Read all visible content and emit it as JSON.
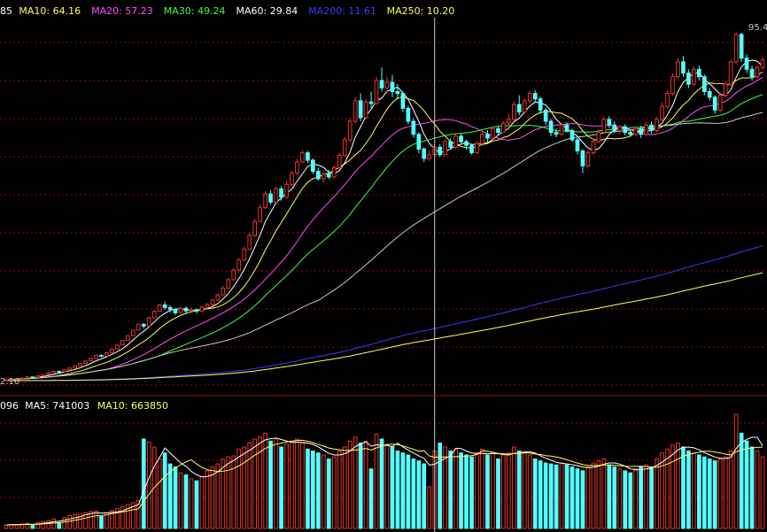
{
  "colors": {
    "background": "#000000",
    "up": "#e8352a",
    "down": "#54ffff",
    "grid": "#8a1010",
    "crosshair": "#c8c8c8",
    "ma5": "#ffffff",
    "ma10": "#ffff5a",
    "ma20": "#ff4cff",
    "ma30": "#3cff3c",
    "ma60": "#c8c8c8",
    "ma200": "#3a3aff",
    "ma250": "#ffff5a",
    "vma5": "#ffffff",
    "vma10": "#ffff5a"
  },
  "price_panel": {
    "legend": [
      {
        "label": "85",
        "color": "#ffffff"
      },
      {
        "label": "MA10: 64.16",
        "color": "#ffff5a"
      },
      {
        "label": "MA20: 57.23",
        "color": "#ff4cff"
      },
      {
        "label": "MA30: 49.24",
        "color": "#3cff3c"
      },
      {
        "label": "MA60: 29.84",
        "color": "#ffffff"
      },
      {
        "label": "MA200: 11.61",
        "color": "#3a3aff"
      },
      {
        "label": "MA250: 10.20",
        "color": "#ffff5a"
      }
    ],
    "max_label": "95.4",
    "min_label": "2.10"
  },
  "volume_panel": {
    "legend": [
      {
        "label": "096",
        "color": "#ffffff"
      },
      {
        "label": "MA5: 741003",
        "color": "#ffffff"
      },
      {
        "label": "MA10: 663850",
        "color": "#ffff5a"
      }
    ]
  },
  "chart_data": {
    "type": "candlestick",
    "price_range": [
      2.1,
      98
    ],
    "volume_range": [
      0,
      1150000
    ],
    "crosshair_index": 81,
    "candles": [
      [
        2.1,
        2.3,
        2.0,
        2.4,
        35000
      ],
      [
        2.3,
        2.5,
        2.2,
        2.6,
        40000
      ],
      [
        2.5,
        2.6,
        2.4,
        2.7,
        38000
      ],
      [
        2.6,
        2.8,
        2.5,
        2.9,
        45000
      ],
      [
        2.8,
        3.1,
        2.7,
        3.2,
        52000
      ],
      [
        3.1,
        3.0,
        2.9,
        3.2,
        30000
      ],
      [
        3.0,
        3.4,
        2.9,
        3.5,
        60000
      ],
      [
        3.4,
        3.8,
        3.3,
        3.9,
        70000
      ],
      [
        3.8,
        4.2,
        3.7,
        4.3,
        80000
      ],
      [
        4.2,
        4.6,
        4.1,
        4.7,
        95000
      ],
      [
        4.6,
        4.5,
        4.3,
        4.8,
        60000
      ],
      [
        4.5,
        5.0,
        4.4,
        5.1,
        110000
      ],
      [
        5.0,
        5.5,
        4.9,
        5.6,
        130000
      ],
      [
        5.5,
        6.1,
        5.4,
        6.2,
        140000
      ],
      [
        6.1,
        6.7,
        6.0,
        6.8,
        150000
      ],
      [
        6.7,
        7.4,
        6.6,
        7.5,
        160000
      ],
      [
        7.4,
        8.1,
        7.3,
        8.2,
        170000
      ],
      [
        8.1,
        8.9,
        8.0,
        9.0,
        175000
      ],
      [
        8.9,
        8.7,
        8.4,
        9.2,
        120000
      ],
      [
        8.7,
        9.6,
        8.6,
        9.7,
        160000
      ],
      [
        9.6,
        10.6,
        9.5,
        10.7,
        180000
      ],
      [
        10.6,
        11.7,
        10.5,
        11.8,
        200000
      ],
      [
        11.7,
        12.9,
        11.6,
        13.0,
        220000
      ],
      [
        12.9,
        14.2,
        12.8,
        14.3,
        240000
      ],
      [
        14.2,
        15.7,
        14.1,
        15.8,
        260000
      ],
      [
        15.7,
        17.3,
        15.6,
        17.4,
        280000
      ],
      [
        17.3,
        16.8,
        16.2,
        17.6,
        900000
      ],
      [
        16.8,
        19.0,
        16.7,
        19.4,
        870000
      ],
      [
        19.0,
        20.8,
        18.9,
        21.2,
        820000
      ],
      [
        20.8,
        22.5,
        20.6,
        22.8,
        700000
      ],
      [
        22.5,
        21.8,
        21.2,
        23.4,
        760000
      ],
      [
        21.8,
        21.3,
        20.5,
        22.4,
        650000
      ],
      [
        21.3,
        20.4,
        19.8,
        21.6,
        620000
      ],
      [
        20.4,
        21.6,
        20.2,
        22.0,
        560000
      ],
      [
        21.6,
        20.9,
        20.3,
        22.1,
        540000
      ],
      [
        20.9,
        21.2,
        20.6,
        21.8,
        500000
      ],
      [
        21.2,
        20.8,
        20.2,
        21.5,
        480000
      ],
      [
        20.8,
        21.9,
        20.7,
        22.2,
        520000
      ],
      [
        21.9,
        22.6,
        21.5,
        23.0,
        580000
      ],
      [
        22.6,
        23.8,
        22.4,
        24.2,
        620000
      ],
      [
        23.8,
        25.2,
        23.6,
        25.6,
        650000
      ],
      [
        25.2,
        27.0,
        25.0,
        27.6,
        700000
      ],
      [
        27.0,
        29.3,
        26.8,
        29.8,
        720000
      ],
      [
        29.3,
        31.9,
        29.0,
        32.4,
        730000
      ],
      [
        31.9,
        34.6,
        31.5,
        35.2,
        800000
      ],
      [
        34.6,
        37.5,
        34.3,
        38.2,
        820000
      ],
      [
        37.5,
        41.2,
        37.2,
        42.0,
        860000
      ],
      [
        41.2,
        45.0,
        40.8,
        45.8,
        900000
      ],
      [
        45.0,
        48.7,
        44.8,
        49.6,
        920000
      ],
      [
        48.7,
        52.4,
        48.3,
        53.2,
        960000
      ],
      [
        52.4,
        50.2,
        49.5,
        53.5,
        880000
      ],
      [
        50.2,
        53.8,
        50.0,
        54.4,
        900000
      ],
      [
        53.8,
        51.5,
        50.6,
        54.5,
        820000
      ],
      [
        51.5,
        55.0,
        51.3,
        55.8,
        850000
      ],
      [
        55.0,
        58.0,
        54.6,
        58.6,
        880000
      ],
      [
        58.0,
        61.0,
        57.6,
        61.8,
        900000
      ],
      [
        61.0,
        63.5,
        60.8,
        64.2,
        870000
      ],
      [
        63.5,
        61.5,
        60.7,
        64.0,
        800000
      ],
      [
        61.5,
        58.5,
        57.8,
        62.0,
        780000
      ],
      [
        58.5,
        56.5,
        56.0,
        59.5,
        760000
      ],
      [
        56.5,
        57.8,
        55.5,
        58.5,
        740000
      ],
      [
        57.8,
        57.0,
        56.4,
        58.9,
        700000
      ],
      [
        57.0,
        59.5,
        56.7,
        60.2,
        720000
      ],
      [
        59.5,
        62.8,
        59.0,
        63.5,
        780000
      ],
      [
        62.8,
        67.0,
        62.5,
        67.8,
        820000
      ],
      [
        67.0,
        72.0,
        66.5,
        72.9,
        880000
      ],
      [
        72.0,
        77.5,
        71.5,
        78.5,
        920000
      ],
      [
        77.5,
        73.0,
        72.0,
        79.5,
        860000
      ],
      [
        73.0,
        77.2,
        72.6,
        78.0,
        880000
      ],
      [
        77.2,
        76.8,
        75.0,
        80.0,
        600000
      ],
      [
        76.8,
        83.0,
        76.5,
        84.0,
        950000
      ],
      [
        83.0,
        81.0,
        80.0,
        86.5,
        900000
      ],
      [
        81.0,
        82.5,
        79.5,
        84.0,
        850000
      ],
      [
        82.5,
        80.0,
        78.5,
        84.5,
        820000
      ],
      [
        80.0,
        79.5,
        77.8,
        82.0,
        780000
      ],
      [
        79.5,
        75.5,
        74.5,
        80.0,
        760000
      ],
      [
        75.5,
        72.0,
        71.2,
        76.2,
        740000
      ],
      [
        72.0,
        68.5,
        67.6,
        72.8,
        700000
      ],
      [
        68.5,
        64.5,
        63.4,
        69.0,
        680000
      ],
      [
        64.5,
        62.0,
        61.0,
        65.0,
        650000
      ],
      [
        62.0,
        63.0,
        61.2,
        64.2,
        420000
      ],
      [
        63.0,
        65.0,
        62.5,
        65.6,
        780000
      ],
      [
        65.0,
        63.0,
        62.4,
        65.8,
        860000
      ],
      [
        63.0,
        66.5,
        62.6,
        67.2,
        820000
      ],
      [
        66.5,
        65.0,
        64.4,
        67.4,
        780000
      ],
      [
        65.0,
        68.0,
        64.6,
        68.8,
        800000
      ],
      [
        68.0,
        66.5,
        66.0,
        68.8,
        760000
      ],
      [
        66.5,
        65.5,
        64.4,
        67.0,
        740000
      ],
      [
        65.5,
        63.5,
        63.0,
        66.0,
        720000
      ],
      [
        63.5,
        66.0,
        63.2,
        66.6,
        760000
      ],
      [
        66.0,
        68.5,
        65.4,
        69.0,
        800000
      ],
      [
        68.5,
        67.5,
        66.2,
        69.6,
        740000
      ],
      [
        67.5,
        70.0,
        67.0,
        70.6,
        760000
      ],
      [
        70.0,
        69.0,
        68.2,
        70.8,
        700000
      ],
      [
        69.0,
        71.5,
        68.8,
        72.0,
        740000
      ],
      [
        71.5,
        72.5,
        70.6,
        74.0,
        760000
      ],
      [
        72.5,
        76.5,
        72.0,
        77.4,
        820000
      ],
      [
        76.5,
        74.5,
        73.6,
        79.0,
        780000
      ],
      [
        74.5,
        77.5,
        74.0,
        78.2,
        760000
      ],
      [
        77.5,
        79.5,
        76.8,
        80.2,
        740000
      ],
      [
        79.5,
        78.0,
        77.2,
        80.4,
        700000
      ],
      [
        78.0,
        75.0,
        74.0,
        78.6,
        680000
      ],
      [
        75.0,
        72.0,
        71.0,
        75.6,
        660000
      ],
      [
        72.0,
        69.0,
        68.0,
        72.6,
        650000
      ],
      [
        69.0,
        68.5,
        67.6,
        70.0,
        640000
      ],
      [
        68.5,
        71.0,
        68.0,
        71.6,
        660000
      ],
      [
        71.0,
        69.5,
        69.0,
        71.8,
        640000
      ],
      [
        69.5,
        67.0,
        66.4,
        70.0,
        620000
      ],
      [
        67.0,
        64.0,
        63.0,
        67.5,
        600000
      ],
      [
        64.0,
        60.0,
        58.0,
        64.5,
        580000
      ],
      [
        60.0,
        63.5,
        59.5,
        64.2,
        620000
      ],
      [
        63.5,
        66.5,
        63.0,
        67.2,
        660000
      ],
      [
        66.5,
        69.0,
        66.0,
        69.8,
        680000
      ],
      [
        69.0,
        72.5,
        68.5,
        73.2,
        700000
      ],
      [
        72.5,
        71.0,
        70.2,
        73.4,
        640000
      ],
      [
        71.0,
        69.5,
        68.8,
        72.0,
        620000
      ],
      [
        69.5,
        70.5,
        68.5,
        71.0,
        600000
      ],
      [
        70.5,
        69.0,
        68.2,
        71.2,
        580000
      ],
      [
        69.0,
        68.5,
        67.8,
        69.5,
        560000
      ],
      [
        68.5,
        70.0,
        68.0,
        70.5,
        600000
      ],
      [
        70.0,
        68.5,
        67.5,
        70.8,
        620000
      ],
      [
        68.5,
        71.0,
        68.0,
        71.8,
        640000
      ],
      [
        71.0,
        69.5,
        68.6,
        72.0,
        620000
      ],
      [
        69.5,
        72.5,
        69.0,
        73.2,
        700000
      ],
      [
        72.5,
        76.0,
        72.0,
        77.0,
        760000
      ],
      [
        76.0,
        79.5,
        75.5,
        80.4,
        800000
      ],
      [
        79.5,
        84.0,
        79.0,
        85.0,
        840000
      ],
      [
        84.0,
        88.0,
        83.5,
        89.0,
        860000
      ],
      [
        88.0,
        85.0,
        84.0,
        89.6,
        820000
      ],
      [
        85.0,
        82.0,
        81.0,
        86.0,
        780000
      ],
      [
        82.0,
        86.0,
        81.5,
        86.8,
        760000
      ],
      [
        86.0,
        84.0,
        83.0,
        87.0,
        740000
      ],
      [
        84.0,
        80.0,
        79.0,
        84.6,
        720000
      ],
      [
        80.0,
        78.5,
        77.5,
        81.0,
        700000
      ],
      [
        78.5,
        75.0,
        74.0,
        79.0,
        680000
      ],
      [
        75.0,
        79.0,
        74.5,
        79.6,
        700000
      ],
      [
        79.0,
        82.0,
        78.5,
        82.8,
        720000
      ],
      [
        82.0,
        88.0,
        81.5,
        88.6,
        780000
      ],
      [
        88.0,
        95.4,
        87.5,
        96.0,
        1150000
      ],
      [
        95.4,
        89.0,
        88.0,
        95.8,
        960000
      ],
      [
        89.0,
        86.0,
        85.0,
        90.0,
        880000
      ],
      [
        86.0,
        84.0,
        83.0,
        87.0,
        820000
      ],
      [
        84.0,
        86.5,
        83.5,
        87.2,
        780000
      ],
      [
        86.5,
        88.5,
        85.8,
        89.4,
        720000
      ]
    ]
  }
}
